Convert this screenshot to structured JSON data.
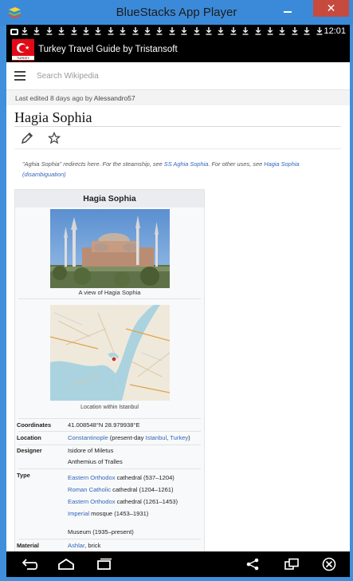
{
  "window": {
    "title": "BlueStacks App Player",
    "close_label": "✕"
  },
  "status": {
    "time": "12:01"
  },
  "app": {
    "title": "Turkey Travel Guide by Tristansoft",
    "flag_text": "TURKEY"
  },
  "search": {
    "placeholder": "Search Wikipedia"
  },
  "lastedit": {
    "prefix": "Last edited 8 days ago by ",
    "author": "Alessandro57"
  },
  "page": {
    "title": "Hagia Sophia"
  },
  "hatnote": {
    "part1": "\"Aghia Sophia\" redirects here. For the steamship, see ",
    "link1": "SS Aghia Sophia",
    "part2": ". For other uses, see ",
    "link2": "Hagia Sophia",
    "link3": "(disambiguation)",
    "part3": "."
  },
  "infobox": {
    "title": "Hagia Sophia",
    "photo_caption": "A view of Hagia Sophia",
    "map_caption": "Location within Istanbul",
    "coordinates_label": "Coordinates",
    "coordinates_value": "41.008548°N 28.979938°E",
    "location_label": "Location",
    "location_link1": "Constantinople",
    "location_text1": " (present-day ",
    "location_link2": "Istanbul",
    "location_text2": ", ",
    "location_link3": "Turkey",
    "location_text3": ")",
    "designer_label": "Designer",
    "designer_1": "Isidore of Miletus",
    "designer_2": "Anthemius of Tralles",
    "type_label": "Type",
    "type_1_link": "Eastern Orthodox",
    "type_1_text": " cathedral (537–1204)",
    "type_2_link": "Roman Catholic",
    "type_2_text": " cathedral (1204–1261)",
    "type_3_link": "Eastern Orthodox",
    "type_3_text": " cathedral (1261–1453)",
    "type_4_link": "Imperial",
    "type_4_text": " mosque (1453–1931)",
    "type_5_text": "Museum (1935–present)",
    "material_label": "Material",
    "material_link": "Ashlar",
    "material_text": ", brick"
  }
}
